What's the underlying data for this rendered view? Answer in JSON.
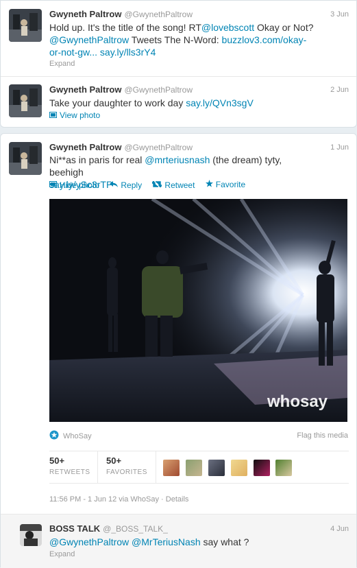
{
  "tweets": [
    {
      "name": "Gwyneth Paltrow",
      "handle": "@GwynethPaltrow",
      "time": "3 Jun",
      "line1_a": "Hold up. It's the title of the song! RT",
      "line1_link": "@lovebscott",
      "line1_b": " Okay or Not?",
      "line2_link1": "@GwynethPaltrow",
      "line2_mid": " Tweets The N-Word: ",
      "line2_link2": "buzzlov3.com/okay-",
      "line3_link": "or-not-gw...",
      "line3_link2": "say.ly/lls3rY4",
      "expand": "Expand"
    },
    {
      "name": "Gwyneth Paltrow",
      "handle": "@GwynethPaltrow",
      "time": "2 Jun",
      "text": "Take your daughter to work day ",
      "link": "say.ly/QVn3sgV",
      "view_photo": "View photo"
    },
    {
      "name": "Gwyneth Paltrow",
      "handle": "@GwynethPaltrow",
      "time": "1 Jun",
      "text_a": "Ni**as in paris for real ",
      "text_link": "@mrteriusnash",
      "text_b": " (the dream) tyty, beehigh",
      "link2": "say.ly/ySc3rTP",
      "hide_photo": "Hide photo",
      "reply": "Reply",
      "retweet": "Retweet",
      "favorite": "Favorite",
      "photo_watermark": "whosay",
      "source_label": "WhoSay",
      "flag_media": "Flag this media",
      "retweets_count": "50+",
      "retweets_label": "RETWEETS",
      "favorites_count": "50+",
      "favorites_label": "FAVORITES",
      "footer": "11:56 PM - 1 Jun 12 via WhoSay · Details"
    }
  ],
  "reply": {
    "name": "BOSS TALK",
    "handle": "@_BOSS_TALK_",
    "time": "4 Jun",
    "link1": "@GwynethPaltrow",
    "link2": "@MrTeriusNash",
    "text": " say what ?",
    "expand": "Expand"
  },
  "colors": {
    "link": "#0084b4",
    "muted": "#999999",
    "text": "#333333"
  },
  "icons": [
    "photo-icon",
    "reply-icon",
    "retweet-icon",
    "star-icon",
    "whosay-icon"
  ]
}
